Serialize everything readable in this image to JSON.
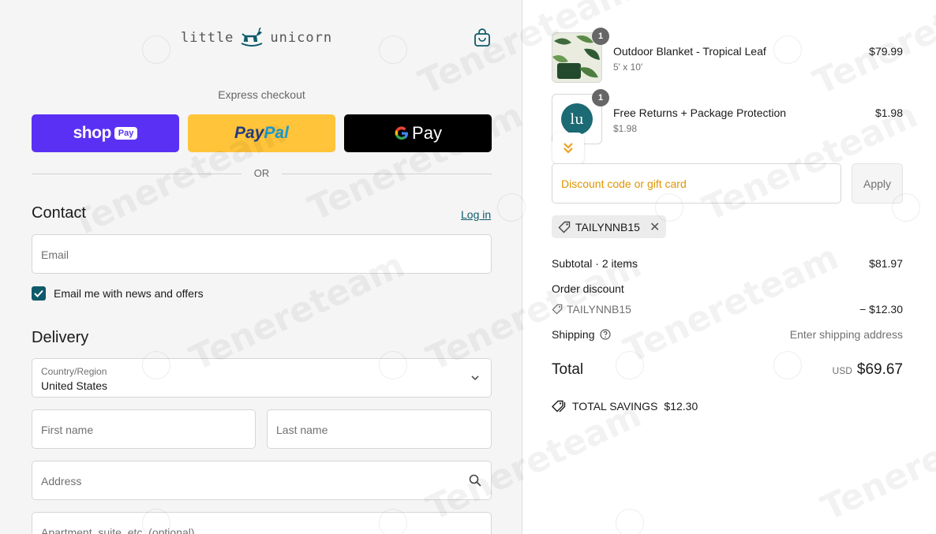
{
  "header": {
    "logo_left": "little",
    "logo_right": "unicorn"
  },
  "express": {
    "title": "Express checkout",
    "shop_word": "shop",
    "shop_pay": "Pay",
    "paypal_pay": "Pay",
    "paypal_pal": "Pal",
    "gpay_word": "Pay",
    "or": "OR"
  },
  "contact": {
    "title": "Contact",
    "login": "Log in",
    "email_placeholder": "Email",
    "newsletter_label": "Email me with news and offers",
    "newsletter_checked": true
  },
  "delivery": {
    "title": "Delivery",
    "country_label": "Country/Region",
    "country_value": "United States",
    "first_name_placeholder": "First name",
    "last_name_placeholder": "Last name",
    "address_placeholder": "Address",
    "apartment_placeholder": "Apartment, suite, etc. (optional)"
  },
  "summary": {
    "items": [
      {
        "name": "Outdoor Blanket - Tropical Leaf",
        "sub": "5' x 10'",
        "price": "$79.99",
        "qty": "1"
      },
      {
        "name": "Free Returns + Package Protection",
        "sub": "$1.98",
        "price": "$1.98",
        "qty": "1",
        "thumb_text": "lu"
      }
    ],
    "discount_placeholder": "Discount code or gift card",
    "apply_label": "Apply",
    "applied_code": "TAILYNNB15",
    "subtotal_label": "Subtotal · 2 items",
    "subtotal_value": "$81.97",
    "order_discount_label": "Order discount",
    "order_discount_code": "TAILYNNB15",
    "order_discount_value": "− $12.30",
    "shipping_label": "Shipping",
    "shipping_value": "Enter shipping address",
    "total_label": "Total",
    "total_currency": "USD",
    "total_value": "$69.67",
    "savings_label": "TOTAL SAVINGS",
    "savings_value": "$12.30"
  },
  "watermark": "Tenereteam",
  "colors": {
    "accent": "#0e5a6a",
    "shop_pay": "#5a31f4",
    "paypal": "#ffc439",
    "gpay": "#000000",
    "discount_placeholder": "#e09500"
  }
}
